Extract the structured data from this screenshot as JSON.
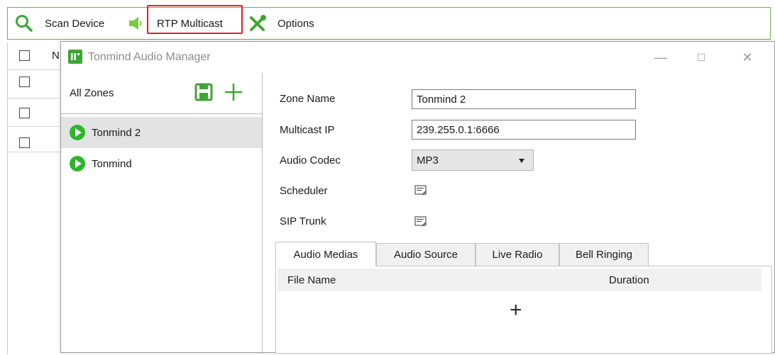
{
  "toolbar": {
    "scan_label": "Scan Device",
    "rtp_label": "RTP Multicast",
    "options_label": "Options",
    "accent": "#3fa535",
    "highlight": "#e0201b"
  },
  "background_table": {
    "header_partial": "N"
  },
  "dialog": {
    "title": "Tonmind Audio Manager",
    "minimize_glyph": "—",
    "maximize_glyph": "☐",
    "close_glyph": "✕"
  },
  "zones": {
    "header": "All Zones",
    "items": [
      {
        "label": "Tonmind 2",
        "selected": true
      },
      {
        "label": "Tonmind",
        "selected": false
      }
    ]
  },
  "form": {
    "zone_name_label": "Zone Name",
    "zone_name_value": "Tonmind 2",
    "multicast_ip_label": "Multicast IP",
    "multicast_ip_value": "239.255.0.1:6666",
    "audio_codec_label": "Audio Codec",
    "audio_codec_value": "MP3",
    "scheduler_label": "Scheduler",
    "sip_trunk_label": "SIP Trunk"
  },
  "tabs": [
    {
      "label": "Audio Medias",
      "active": true
    },
    {
      "label": "Audio Source",
      "active": false
    },
    {
      "label": "Live Radio",
      "active": false
    },
    {
      "label": "Bell Ringing",
      "active": false
    }
  ],
  "media_table": {
    "col_file": "File Name",
    "col_duration": "Duration",
    "add_glyph": "+"
  },
  "icons": [
    "search-icon",
    "speaker-icon",
    "tools-icon",
    "save-icon",
    "add-icon",
    "play-icon",
    "scheduler-edit-icon"
  ]
}
